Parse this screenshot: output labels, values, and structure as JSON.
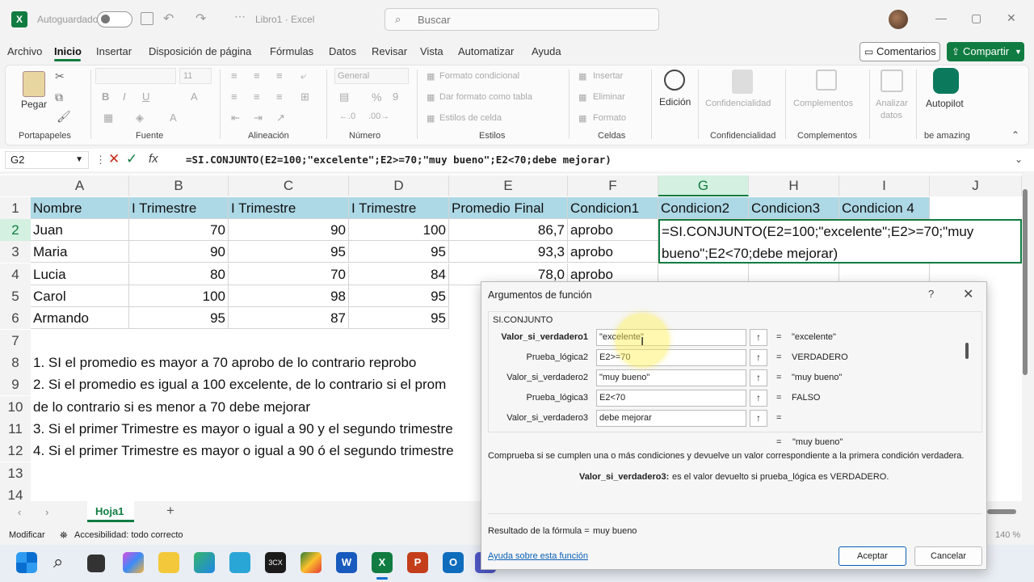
{
  "titlebar": {
    "autosave": "Autoguardado",
    "doc": "Libro1 · Excel",
    "search": "Buscar"
  },
  "menu": [
    "Archivo",
    "Inicio",
    "Insertar",
    "Disposición de página",
    "Fórmulas",
    "Datos",
    "Revisar",
    "Vista",
    "Automatizar",
    "Ayuda"
  ],
  "menu_buttons": {
    "comments": "Comentarios",
    "share": "Compartir"
  },
  "ribbon": {
    "paste": "Pegar",
    "font_name": "",
    "font_size": "11",
    "number_format": "General",
    "cond_format": "Formato condicional",
    "table_format": "Dar formato como tabla",
    "cell_styles": "Estilos de celda",
    "insert": "Insertar",
    "delete": "Eliminar",
    "format": "Formato",
    "edit": "Edición",
    "confidentiality": "Confidencialidad",
    "addins": "Complementos",
    "analyze1": "Analizar",
    "analyze2": "datos",
    "autopilot": "Autopilot",
    "groups": {
      "clipboard": "Portapapeles",
      "font": "Fuente",
      "alignment": "Alineación",
      "number": "Número",
      "styles": "Estilos",
      "cells": "Celdas",
      "confidentiality": "Confidencialidad",
      "addins": "Complementos",
      "be_amazing": "be amazing"
    }
  },
  "formula_bar": {
    "name_box": "G2",
    "fx": "fx",
    "formula": "=SI.CONJUNTO(E2=100;\"excelente\";E2>=70;\"muy bueno\";E2<70;debe mejorar)"
  },
  "columns": [
    "A",
    "B",
    "C",
    "D",
    "E",
    "F",
    "G",
    "H",
    "I",
    "J"
  ],
  "rows": [
    "1",
    "2",
    "3",
    "4",
    "5",
    "6",
    "7",
    "8",
    "9",
    "10",
    "11",
    "12",
    "13",
    "14"
  ],
  "headers": [
    "Nombre",
    "I Trimestre",
    "I Trimestre",
    "I Trimestre",
    "Promedio Final",
    "Condicion1",
    "Condicion2",
    "Condicion3",
    "Condicion 4"
  ],
  "data": [
    [
      "Juan",
      "70",
      "90",
      "100",
      "86,7",
      "aprobo"
    ],
    [
      "Maria",
      "90",
      "95",
      "95",
      "93,3",
      "aprobo"
    ],
    [
      "Lucia",
      "80",
      "70",
      "84",
      "78,0",
      "aprobo"
    ],
    [
      "Carol",
      "100",
      "98",
      "95",
      "",
      ""
    ],
    [
      "Armando",
      "95",
      "87",
      "95",
      "",
      ""
    ]
  ],
  "g2_line1": "=SI.CONJUNTO(E2=100;\"excelente\";E2>=70;\"muy",
  "g2_line2": "bueno\";E2<70;debe mejorar)",
  "notes": {
    "r8": "1. SI el promedio es mayor a 70 aprobo de lo contrario reprobo",
    "r9": "2. Si el promedio es igual a 100 excelente, de lo contrario si el prom",
    "r10": "de lo contrario si es menor a 70 debe mejorar",
    "r11": "3. Si el primer Trimestre es mayor o igual a 90 y el segundo trimestre",
    "r12": "4. Si el primer Trimestre es mayor o igual a 90 ó el segundo trimestre"
  },
  "sheet_tab": "Hoja1",
  "status": {
    "mode": "Modificar",
    "accessibility": "Accesibilidad: todo correcto",
    "zoom": "140 %"
  },
  "dialog": {
    "title": "Argumentos de función",
    "help": "?",
    "func": "SI.CONJUNTO",
    "args": [
      {
        "label": "Valor_si_verdadero1",
        "value": "\"excelente\"",
        "result": "\"excelente\"",
        "bold": true
      },
      {
        "label": "Prueba_lógica2",
        "value": "E2>=70",
        "result": "VERDADERO",
        "bold": false
      },
      {
        "label": "Valor_si_verdadero2",
        "value": "\"muy bueno\"",
        "result": "\"muy bueno\"",
        "bold": false
      },
      {
        "label": "Prueba_lógica3",
        "value": "E2<70",
        "result": "FALSO",
        "bold": false
      },
      {
        "label": "Valor_si_verdadero3",
        "value": "debe mejorar",
        "result": "",
        "bold": false
      }
    ],
    "overall_result": "\"muy bueno\"",
    "description": "Comprueba si se cumplen una o más condiciones y devuelve un valor correspondiente a la primera condición verdadera.",
    "arg_name": "Valor_si_verdadero3:",
    "arg_desc": "es el valor devuelto si prueba_lógica es VERDADERO.",
    "result_label": "Resultado de la fórmula =",
    "result_value": "muy bueno",
    "help_link": "Ayuda sobre esta función",
    "ok": "Aceptar",
    "cancel": "Cancelar"
  }
}
